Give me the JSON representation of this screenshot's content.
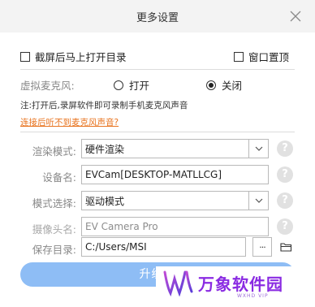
{
  "window": {
    "title": "更多设置"
  },
  "options": {
    "open_dir_after_capture": {
      "label": "截屏后马上打开目录",
      "checked": false
    },
    "window_on_top": {
      "label": "窗口置顶",
      "checked": false
    }
  },
  "mic": {
    "label": "虚拟麦克风:",
    "on_label": "打开",
    "off_label": "关闭",
    "selected": "off",
    "note": "注:打开后,录屏软件即可录制手机麦克风声音",
    "help_link": "连接后听不到麦克风声音?"
  },
  "settings": {
    "render_mode": {
      "label": "渲染模式:",
      "value": "硬件渲染"
    },
    "device_name": {
      "label": "设备名:",
      "value": "EVCam[DESKTOP-MATLLCG]"
    },
    "mode_select": {
      "label": "模式选择:",
      "value": "驱动模式"
    },
    "camera_name": {
      "label": "摄像头名:",
      "value": "EV Camera Pro"
    },
    "save_dir": {
      "label": "保存目录:",
      "value": "C:/Users/MSI"
    }
  },
  "help_glyph": "?",
  "more_glyph": "···",
  "upgrade_button": {
    "label": "升级到"
  },
  "watermark": {
    "text": "万象软件园",
    "sub": "WXHD VIP"
  }
}
